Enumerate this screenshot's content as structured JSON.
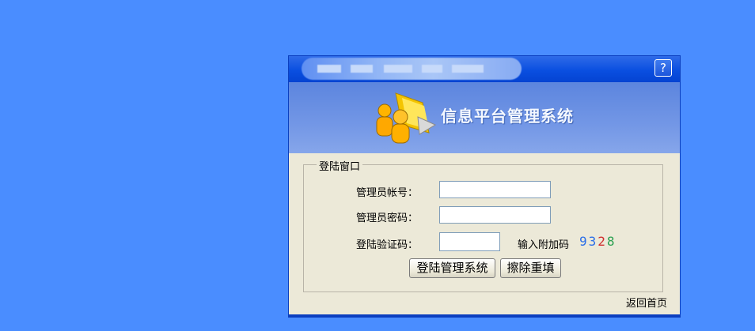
{
  "help_button": "?",
  "banner": {
    "title": "信息平台管理系统"
  },
  "login": {
    "legend": "登陆窗口",
    "username_label": "管理员帐号：",
    "password_label": "管理员密码：",
    "captcha_label": "登陆验证码：",
    "captcha_hint": "输入附加码",
    "captcha_digits": [
      {
        "d": "9",
        "color": "#2a6ee8"
      },
      {
        "d": "3",
        "color": "#2a6ee8"
      },
      {
        "d": "2",
        "color": "#d03030"
      },
      {
        "d": "8",
        "color": "#2aa050"
      }
    ],
    "username_value": "",
    "password_value": "",
    "captcha_value": "",
    "submit_label": "登陆管理系统",
    "reset_label": "擦除重填"
  },
  "footer": {
    "back_link": "返回首页"
  },
  "colors": {
    "background": "#4a8dff",
    "titlebar": "#0a4fe0",
    "panel": "#ece9d8"
  }
}
